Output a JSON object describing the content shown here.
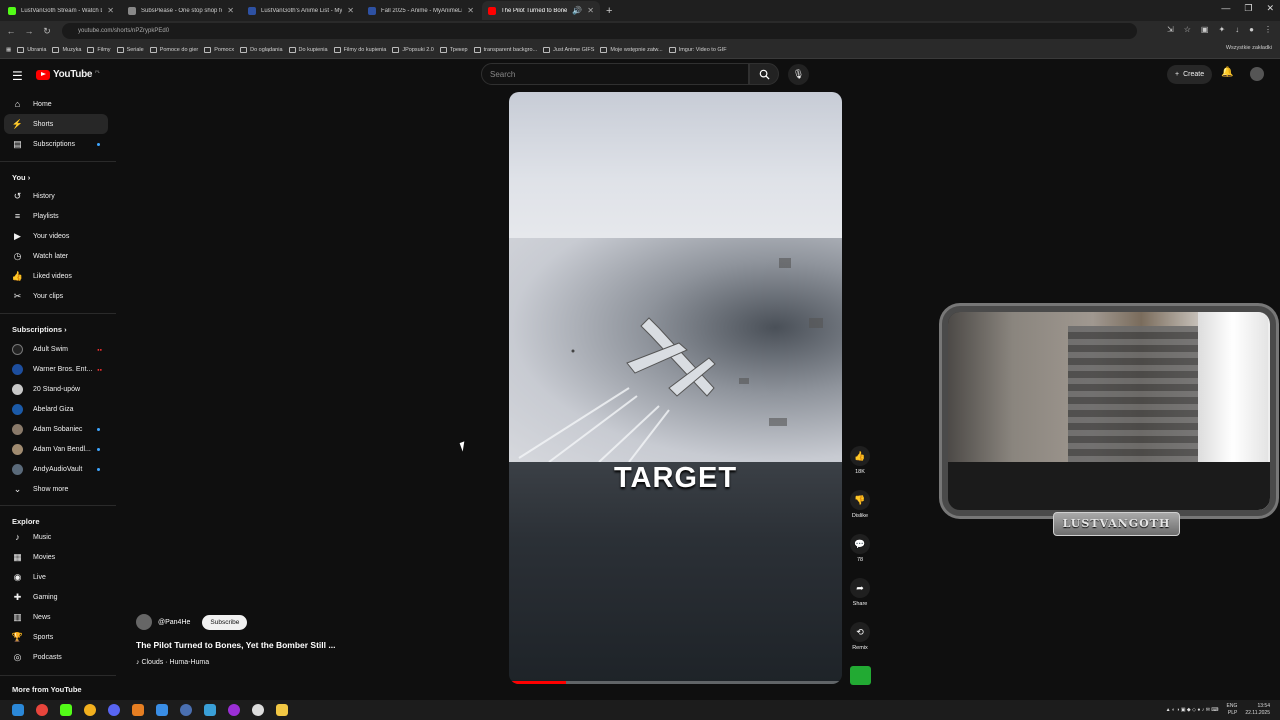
{
  "browser": {
    "tabs": [
      {
        "label": "LustVanGoth Stream - Watch Li",
        "color": "#53fc18"
      },
      {
        "label": "SubsPlease - One stop shop fo",
        "color": "#888888"
      },
      {
        "label": "LustVanGoth's Anime List - My",
        "color": "#2e51a2"
      },
      {
        "label": "Fall 2025 - Anime - MyAnimeLi",
        "color": "#2e51a2"
      },
      {
        "label": "The Pilot Turned to Bones",
        "color": "#ff0000"
      }
    ],
    "url": "youtube.com/shorts/nPZrypkPEd0",
    "bookmarks": [
      "Ubrania",
      "Muzyka",
      "Filmy",
      "Seriale",
      "Pomoce do gier",
      "Pomocx",
      "Do oglądania",
      "Do kupienia",
      "Filmy do kupienia",
      "JPopsuki 2.0",
      "Трекер",
      "transparent backgro...",
      "Just Anime GIFS",
      "Moje wstępnie zatw...",
      "Imgur: Video to GIF"
    ],
    "bookmarks_right": "Wszystkie zakładki"
  },
  "header": {
    "logo": "YouTube",
    "region": "PL",
    "search_placeholder": "Search",
    "create_label": "Create"
  },
  "sidebar": {
    "main": [
      "Home",
      "Shorts",
      "Subscriptions"
    ],
    "you_header": "You",
    "you": [
      "History",
      "Playlists",
      "Your videos",
      "Watch later",
      "Liked videos",
      "Your clips"
    ],
    "subs_header": "Subscriptions",
    "subs": [
      "Adult Swim",
      "Warner Bros. Ent...",
      "20 Stand-upów",
      "Abelard Giza",
      "Adam Sobaniec",
      "Adam Van Bendl...",
      "AndyAudioVault"
    ],
    "show_more": "Show more",
    "explore_header": "Explore",
    "explore": [
      "Music",
      "Movies",
      "Live",
      "Gaming",
      "News",
      "Sports",
      "Podcasts"
    ],
    "more_header": "More from YouTube"
  },
  "short": {
    "caption": "TARGET",
    "progress": 0.17,
    "channel": "@Pan4He",
    "subscribe": "Subscribe",
    "title": "The Pilot Turned to Bones, Yet the Bomber Still ...",
    "song": "♪ Clouds · Huma-Huma"
  },
  "actions": {
    "likes": "18K",
    "dislike": "Dislike",
    "comments": "78",
    "share": "Share",
    "remix": "Remix"
  },
  "overlay": {
    "nameplate": "LUSTVANGOTH"
  },
  "taskbar": {
    "lang": "ENG",
    "locale": "PLP",
    "time": "13:54",
    "date": "22.11.2025"
  }
}
